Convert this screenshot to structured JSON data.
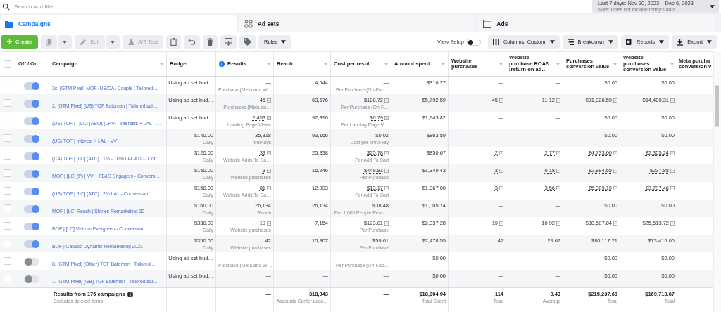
{
  "search": {
    "placeholder": "Search and filter"
  },
  "date_range": {
    "label": "Last 7 days: Nov 30, 2023 – Dec 6, 2023",
    "note": "Note: Does not include today's data"
  },
  "tabs": [
    {
      "label": "Campaigns",
      "selected": true
    },
    {
      "label": "Ad sets",
      "selected": false
    },
    {
      "label": "Ads",
      "selected": false
    }
  ],
  "toolbar": {
    "actions": [
      {
        "kind": "create",
        "label": "Create",
        "disabled": false
      },
      {
        "kind": "duplicate",
        "disabled": true
      },
      {
        "kind": "edit",
        "label": "Edit",
        "disabled": true
      },
      {
        "kind": "abtest",
        "label": "A/B Test",
        "disabled": true
      },
      {
        "kind": "clipboard",
        "disabled": false
      },
      {
        "kind": "undo",
        "disabled": false
      },
      {
        "kind": "delete",
        "disabled": false
      },
      {
        "kind": "preview",
        "disabled": false
      },
      {
        "kind": "tag",
        "disabled": false
      },
      {
        "kind": "rules",
        "label": "Rules",
        "disabled": false
      }
    ],
    "view_setup": {
      "label": "View Setup",
      "on": false
    },
    "menus": [
      {
        "kind": "columns",
        "label": "Columns: Custom"
      },
      {
        "kind": "breakdown",
        "label": "Breakdown"
      },
      {
        "kind": "reports",
        "label": "Reports"
      },
      {
        "kind": "export",
        "label": "Export"
      }
    ]
  },
  "select_all": {
    "checked": false
  },
  "columns": [
    {
      "label": "Off / On",
      "sortable": false,
      "info": false
    },
    {
      "label": "Campaign",
      "sortable": true,
      "info": false
    },
    {
      "label": "Budget",
      "sortable": false,
      "info": false
    },
    {
      "label": "Results",
      "sortable": true,
      "info": true
    },
    {
      "label": "Reach",
      "sortable": true,
      "info": false
    },
    {
      "label": "Cost per result",
      "sortable": true,
      "info": false
    },
    {
      "label": "Amount spent",
      "sortable": true,
      "info": false
    },
    {
      "label": "Website purchases",
      "sortable": true,
      "info": false
    },
    {
      "label": "Website purchase ROAS (return on ad…",
      "sortable": true,
      "info": false
    },
    {
      "label": "Purchases conversion value",
      "sortable": true,
      "info": false
    },
    {
      "label": "Website purchases conversion value",
      "sortable": true,
      "info": false
    },
    {
      "label": "Meta purcha conversion v",
      "sortable": false,
      "info": false
    }
  ],
  "rows": [
    {
      "checked": false,
      "on": true,
      "name": "3c. [GTM Pixel] MOF (US/CA) Couple | Tailored…",
      "cells": [
        {
          "value": "Using ad set bud…",
          "linked": false
        },
        {
          "value": "—",
          "sub": "Purchase (Meta and W…",
          "linked": false
        },
        {
          "value": "4,544",
          "linked": false
        },
        {
          "value": "—",
          "sub": "Per Purchase (On-Fac…",
          "linked": false
        },
        {
          "value": "$316.27",
          "linked": false
        },
        {
          "value": "—",
          "linked": false
        },
        {
          "value": "—",
          "linked": false
        },
        {
          "value": "$0.00",
          "linked": false
        },
        {
          "value": "$0.00",
          "linked": false
        }
      ]
    },
    {
      "checked": false,
      "on": true,
      "name": "2. [GTM Pixel] (US) TOF Bateman | Tailored sal…",
      "cells": [
        {
          "value": "Using ad set bud…",
          "linked": false
        },
        {
          "value": "45",
          "sub": "Purchases (Meta an…",
          "linked": true
        },
        {
          "value": "63,676",
          "linked": false
        },
        {
          "value": "$128.72",
          "sub": "Per Purchase (On-F…",
          "linked": true
        },
        {
          "value": "$5,792.59",
          "linked": false
        },
        {
          "value": "45",
          "linked": true
        },
        {
          "value": "11.12",
          "linked": true
        },
        {
          "value": "$91,826.59",
          "linked": true
        },
        {
          "value": "$64,400.31",
          "linked": true
        }
      ]
    },
    {
      "checked": false,
      "on": true,
      "name": "(US) TOF | | [LC] (ABO) (LPV) | Interests + LAL - …",
      "cells": [
        {
          "value": "Using ad set bud…",
          "linked": false
        },
        {
          "value": "2,453",
          "sub": "Landing Page Views",
          "linked": true
        },
        {
          "value": "92,390",
          "linked": false
        },
        {
          "value": "$0.79",
          "sub": "Per Landing Page V…",
          "linked": true
        },
        {
          "value": "$1,943.82",
          "linked": false
        },
        {
          "value": "—",
          "linked": false
        },
        {
          "value": "—",
          "linked": false
        },
        {
          "value": "$0.00",
          "linked": false
        },
        {
          "value": "$0.00",
          "linked": false
        }
      ]
    },
    {
      "checked": false,
      "on": true,
      "name": "(US) TOF | Interest + LAL - VV",
      "cells": [
        {
          "value": "$140.00",
          "sub": "Daily",
          "linked": false
        },
        {
          "value": "35,818",
          "sub": "ThruPlays",
          "linked": false
        },
        {
          "value": "93,166",
          "linked": false
        },
        {
          "value": "$0.02",
          "sub": "Cost per ThruPlay",
          "linked": false
        },
        {
          "value": "$863.59",
          "linked": false
        },
        {
          "value": "—",
          "linked": false
        },
        {
          "value": "—",
          "linked": false
        },
        {
          "value": "$0.00",
          "linked": false
        },
        {
          "value": "$0.00",
          "linked": false
        }
      ]
    },
    {
      "checked": false,
      "on": true,
      "name": "(CA) TOF | [LC] (ATC) | 1% - 10% LAL ATC - Con…",
      "cells": [
        {
          "value": "$120.00",
          "sub": "Daily",
          "linked": false
        },
        {
          "value": "33",
          "sub": "Website Adds To Ca…",
          "linked": true
        },
        {
          "value": "25,338",
          "linked": false
        },
        {
          "value": "$25.78",
          "sub": "Per Add To Cart",
          "linked": true
        },
        {
          "value": "$850.67",
          "linked": false
        },
        {
          "value": "2",
          "linked": true
        },
        {
          "value": "2.77",
          "linked": true
        },
        {
          "value": "$4,733.00",
          "linked": true
        },
        {
          "value": "$2,355.24",
          "linked": true
        }
      ]
    },
    {
      "checked": false,
      "on": true,
      "name": "MOF | [LC] (P) | VV + FB/IG Engagers - Convers…",
      "cells": [
        {
          "value": "$150.00",
          "sub": "Daily",
          "linked": false
        },
        {
          "value": "3",
          "sub": "Website purchases",
          "linked": true
        },
        {
          "value": "16,946",
          "linked": false
        },
        {
          "value": "$449.81",
          "sub": "Per Purchase",
          "linked": true
        },
        {
          "value": "$1,349.43",
          "linked": false
        },
        {
          "value": "3",
          "linked": true
        },
        {
          "value": "0.18",
          "linked": true
        },
        {
          "value": "$2,884.65",
          "linked": true
        },
        {
          "value": "$237.88",
          "linked": true
        }
      ]
    },
    {
      "checked": false,
      "on": true,
      "name": "(US) TOF | [LC] (ATC) | 2% LAL - Conversion",
      "cells": [
        {
          "value": "$150.00",
          "sub": "Daily",
          "linked": false
        },
        {
          "value": "81",
          "sub": "Website Adds To Ca…",
          "linked": true
        },
        {
          "value": "12,993",
          "linked": false
        },
        {
          "value": "$13.17",
          "sub": "Per Add To Cart",
          "linked": true
        },
        {
          "value": "$1,067.00",
          "linked": false
        },
        {
          "value": "3",
          "linked": true
        },
        {
          "value": "3.56",
          "linked": true
        },
        {
          "value": "$5,089.19",
          "linked": true
        },
        {
          "value": "$3,797.46",
          "linked": true
        }
      ]
    },
    {
      "checked": false,
      "on": true,
      "name": "MOF | [LC] Reach | Stories Remarketing 30",
      "cells": [
        {
          "value": "$160.00",
          "sub": "Daily",
          "linked": false
        },
        {
          "value": "26,134",
          "sub": "Reach",
          "linked": false
        },
        {
          "value": "26,134",
          "linked": false
        },
        {
          "value": "$38.48",
          "sub": "Per 1,000 People Reac…",
          "linked": false
        },
        {
          "value": "$1,005.74",
          "linked": false
        },
        {
          "value": "—",
          "linked": false
        },
        {
          "value": "—",
          "linked": false
        },
        {
          "value": "$0.00",
          "linked": false
        },
        {
          "value": "$0.00",
          "linked": false
        }
      ]
    },
    {
      "checked": false,
      "on": true,
      "name": "BOF | [LC] Visitors Evergreen - Conversion",
      "cells": [
        {
          "value": "$330.00",
          "sub": "Daily",
          "linked": false
        },
        {
          "value": "19",
          "sub": "Website purchases",
          "linked": true
        },
        {
          "value": "7,154",
          "linked": false
        },
        {
          "value": "$123.01",
          "sub": "Per Purchase",
          "linked": true
        },
        {
          "value": "$2,337.28",
          "linked": false
        },
        {
          "value": "19",
          "linked": true
        },
        {
          "value": "10.92",
          "linked": true
        },
        {
          "value": "$30,587.04",
          "linked": true
        },
        {
          "value": "$25,513.72",
          "linked": true
        }
      ]
    },
    {
      "checked": false,
      "on": true,
      "name": "BOF | Catalog Dynamic Remarketing 2021",
      "cells": [
        {
          "value": "$350.00",
          "sub": "Daily",
          "linked": false
        },
        {
          "value": "42",
          "sub": "Website purchases",
          "linked": false
        },
        {
          "value": "10,307",
          "linked": false
        },
        {
          "value": "$59.01",
          "sub": "Per Purchase",
          "linked": false
        },
        {
          "value": "$2,478.55",
          "linked": false
        },
        {
          "value": "42",
          "linked": false
        },
        {
          "value": "29.62",
          "linked": false
        },
        {
          "value": "$80,117.21",
          "linked": false
        },
        {
          "value": "$73,415.06",
          "linked": false
        }
      ]
    },
    {
      "checked": false,
      "on": false,
      "name": "8. [GTM Pixel] (Other) TOF Bateman | Tailored …",
      "cells": [
        {
          "value": "Using ad set bud…",
          "linked": false
        },
        {
          "value": "—",
          "sub": "Purchase (Meta and W…",
          "linked": false
        },
        {
          "value": "—",
          "linked": false
        },
        {
          "value": "—",
          "sub": "Per Purchase (On-Fac…",
          "linked": false
        },
        {
          "value": "$0.00",
          "linked": false
        },
        {
          "value": "—",
          "linked": false
        },
        {
          "value": "—",
          "linked": false
        },
        {
          "value": "$0.00",
          "linked": false
        },
        {
          "value": "$0.00",
          "linked": false
        }
      ]
    },
    {
      "checked": false,
      "on": false,
      "name": "7. [GTM Pixel] (GB) TOF Bateman | Tailored sal…",
      "cells": [
        {
          "value": "Using ad set bud…",
          "linked": false
        },
        {
          "value": "—",
          "linked": false
        },
        {
          "value": "—",
          "linked": false
        },
        {
          "value": "—",
          "linked": false
        },
        {
          "value": "$0.00",
          "linked": false
        },
        {
          "value": "—",
          "linked": false
        },
        {
          "value": "—",
          "linked": false
        },
        {
          "value": "$0.00",
          "linked": false
        },
        {
          "value": "$0.00",
          "linked": false
        }
      ]
    }
  ],
  "footer": {
    "title": "Results from 176 campaigns",
    "note": "Excludes deleted items",
    "cells": [
      {
        "value": "—",
        "linked": false
      },
      {
        "value": "318,943",
        "sub": "Accounts Center acco…",
        "linked": true
      },
      {
        "value": "—",
        "linked": false
      },
      {
        "value": "$18,004.94",
        "sub": "Total Spent",
        "linked": false
      },
      {
        "value": "114",
        "sub": "Total",
        "linked": false
      },
      {
        "value": "9.43",
        "sub": "Average",
        "linked": false
      },
      {
        "value": "$215,237.68",
        "sub": "Total",
        "linked": false
      },
      {
        "value": "$169,719.67",
        "sub": "Total",
        "linked": false
      }
    ]
  }
}
